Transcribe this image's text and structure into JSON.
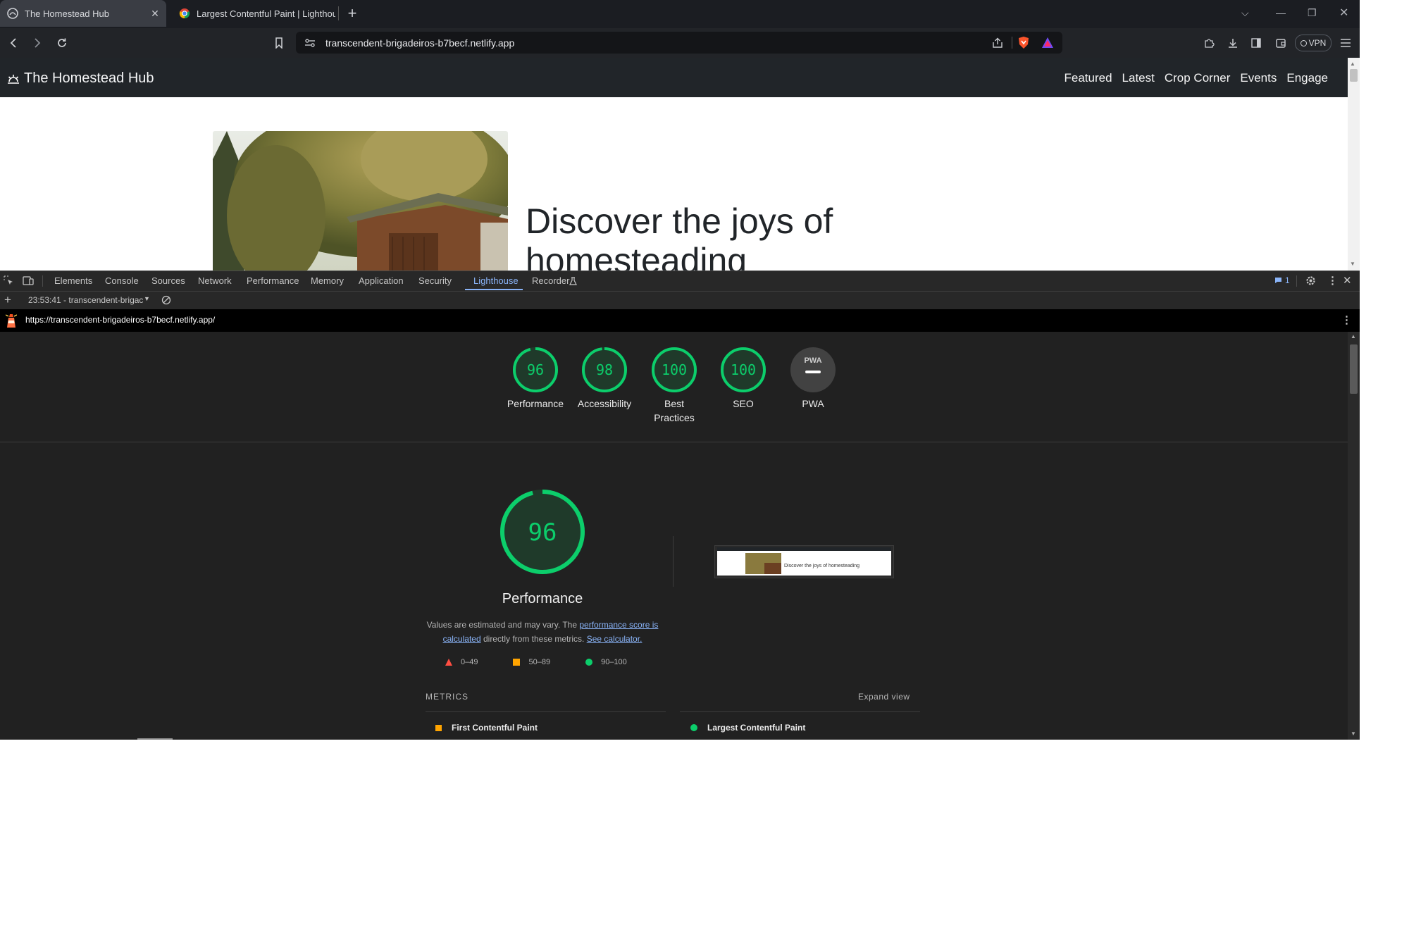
{
  "browser": {
    "tabs": [
      {
        "title": "The Homestead Hub",
        "active": true
      },
      {
        "title": "Largest Contentful Paint  |  Lighthou",
        "active": false
      }
    ],
    "url": "transcendent-brigadeiros-b7becf.netlify.app",
    "vpn_label": "VPN"
  },
  "site": {
    "brand": "The Homestead Hub",
    "nav": [
      "Featured",
      "Latest",
      "Crop Corner",
      "Events",
      "Engage"
    ],
    "hero_title": "Discover the joys of homesteading"
  },
  "devtools": {
    "tabs": [
      "Elements",
      "Console",
      "Sources",
      "Network",
      "Performance",
      "Memory",
      "Application",
      "Security",
      "Lighthouse",
      "Recorder"
    ],
    "selected_tab": "Lighthouse",
    "issues_count": "1",
    "report_select": "23:53:41 - transcendent-brigac",
    "report_url": "https://transcendent-brigadeiros-b7becf.netlify.app/"
  },
  "lighthouse": {
    "scores": [
      {
        "label": "Performance",
        "value": "96",
        "pct": 0.96
      },
      {
        "label": "Accessibility",
        "value": "98",
        "pct": 0.98
      },
      {
        "label": "Best Practices",
        "value": "100",
        "pct": 1.0
      },
      {
        "label": "SEO",
        "value": "100",
        "pct": 1.0
      }
    ],
    "pwa_label": "PWA",
    "pwa_badge": "PWA",
    "big_score": "96",
    "big_title": "Performance",
    "desc_1": "Values are estimated and may vary. The ",
    "desc_link_1": "performance score is calculated",
    "desc_2": " directly from these metrics. ",
    "desc_link_2": "See calculator.",
    "legend": [
      "0–49",
      "50–89",
      "90–100"
    ],
    "metrics_heading": "METRICS",
    "expand_view": "Expand view",
    "metrics": [
      "First Contentful Paint",
      "Largest Contentful Paint"
    ],
    "thumb_text": "Discover the joys of homesteading",
    "colors": {
      "pass": "#0cce6b",
      "average": "#ffa400",
      "fail": "#ff4e42"
    }
  }
}
